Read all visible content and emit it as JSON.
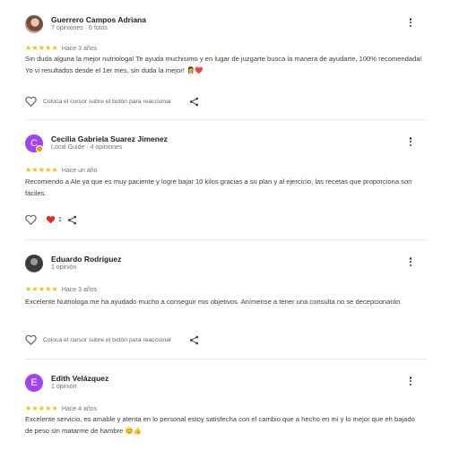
{
  "colors": {
    "star": "#fbbc04",
    "heart": "#d93025",
    "avatar_purple": "#a142f4"
  },
  "reviews": [
    {
      "name": "Guerrero Campos Adriana",
      "meta": "7 opiniones · 6 fotos",
      "stars": "★★★★★",
      "rating": 5,
      "when": "Hace 3 años",
      "text": "Sin duda alguna la mejor nutriologa! Te ayuda muchisimo y en lugar de juzgarte busca la manera de ayudarte, 100% recomendada! Yo vi resultados desde el 1er mes, sin duda la mejor!",
      "emojis": "👩‍⚕️❤️",
      "hint": "Coloca el cursor sobre el botón para reaccionar"
    },
    {
      "name": "Cecilia Gabriela Suarez Jimenez",
      "initial": "C",
      "meta": "Local Guide · 4 opiniones",
      "stars": "★★★★★",
      "rating": 5,
      "when": "Hace un año",
      "text": "Recomiendo a Ale ya que es muy paciente y logre bajar 10 kilos gracias a su plan y al ejercicio, las recetas que proporciona son fáciles.",
      "reaction_count": "1"
    },
    {
      "name": "Eduardo Rodríguez",
      "meta": "1 opinión",
      "stars": "★★★★★",
      "rating": 5,
      "when": "Hace 3 años",
      "text": "Excelente Nutriologa me ha ayudado mucho a conseguir mis objetivos. Anímense a tener una consulta no se decepcionarán",
      "hint": "Coloca el cursor sobre el botón para reaccionar"
    },
    {
      "name": "Edith Velázquez",
      "initial": "E",
      "meta": "1 opinión",
      "stars": "★★★★★",
      "rating": 5,
      "when": "Hace 4 años",
      "text": "Excelente servicio, es amable y atenta en lo personal estoy satisfecha con el cambio que a hecho en mi y lo mejor que eh bajado de peso sin matarme de hambre",
      "emojis": "😊👍"
    }
  ]
}
